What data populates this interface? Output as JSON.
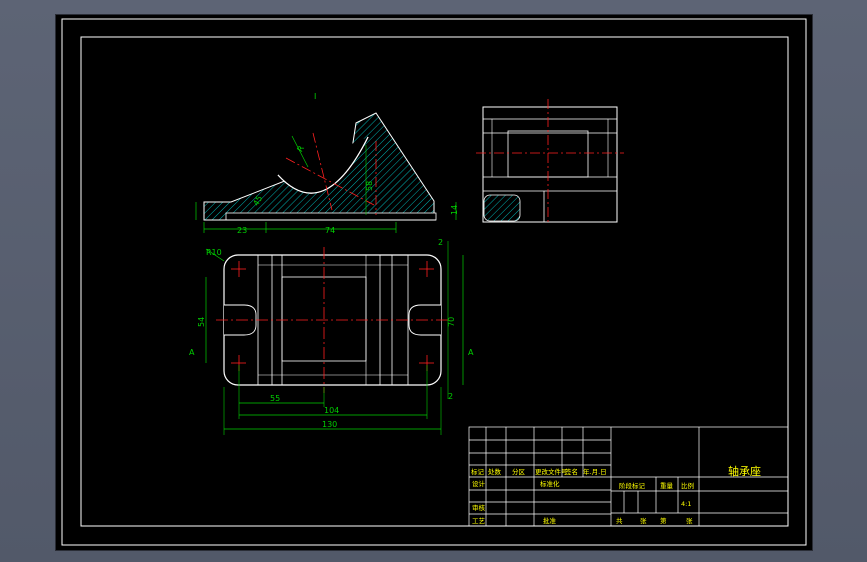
{
  "colors": {
    "background": "#000000",
    "outline": "#ffffff",
    "center_line": "#ff2020",
    "dimension": "#00d000",
    "hatch": "#00e0e0",
    "text": "#ffff00",
    "frame_bg": "#5b6273"
  },
  "front_view": {
    "label": "Ⅰ",
    "dims": {
      "d23": "23",
      "d74": "74",
      "d14": "14",
      "d58": "58",
      "d45": "45",
      "dR": "R"
    }
  },
  "top_view": {
    "dims": {
      "r10": "R10",
      "d54": "54",
      "d70": "70",
      "d55": "55",
      "d104": "104",
      "d130": "130",
      "mark_a": "A",
      "mark_b": "A",
      "mark_2a": "2",
      "mark_2b": "2"
    }
  },
  "title_block": {
    "part_name": "轴承座",
    "headers": [
      "标记",
      "处数",
      "分区",
      "更改文件号",
      "签名",
      "年.月.日"
    ],
    "design": "设计",
    "standardization": "标准化",
    "review": "审核",
    "process": "工艺",
    "approve": "批准",
    "stage_mark": "阶段标记",
    "weight": "重量",
    "scale": "比例",
    "scale_value": "4:1",
    "sheets_total": "共",
    "sheets_unit1": "张",
    "sheet_no": "第",
    "sheets_unit2": "张"
  }
}
